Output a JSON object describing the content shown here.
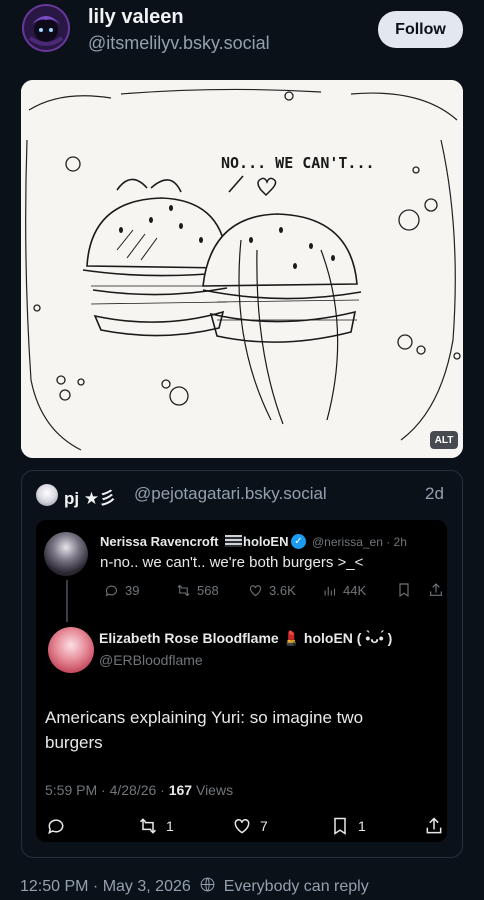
{
  "post": {
    "author_name": "lily valeen",
    "author_handle": "@itsmelilyv.bsky.social",
    "follow_label": "Follow",
    "drawing_caption": "NO... WE CAN'T...",
    "alt_label": "ALT",
    "footer_time": "12:50 PM · May 3, 2026",
    "reply_setting": "Everybody can reply"
  },
  "quote": {
    "author_name": "pj ★彡",
    "author_handle": "@pejotagatari.bsky.social",
    "age": "2d"
  },
  "embedded": {
    "nerissa": {
      "name": "Nerissa Ravencroft",
      "name_suffix": "holoEN",
      "meta": "@nerissa_en · 2h",
      "text": "n-no.. we can't.. we're both burgers >_<",
      "replies": "39",
      "reposts": "568",
      "likes": "3.6K",
      "views": "44K"
    },
    "elizabeth": {
      "name": "Elizabeth Rose Bloodflame 💄 holoEN ( •̀ᴗ•́ )",
      "handle": "@ERBloodflame",
      "text": "Americans explaining Yuri: so imagine two burgers",
      "meta_time": "5:59 PM · 4/28/26 · ",
      "views_count": "167",
      "views_label": " Views",
      "reposts": "1",
      "likes": "7",
      "bookmarks": "1"
    }
  },
  "colors": {
    "background": "#0b1118",
    "accent_verified": "#1d9bf0",
    "muted_text": "#93a0ae"
  }
}
